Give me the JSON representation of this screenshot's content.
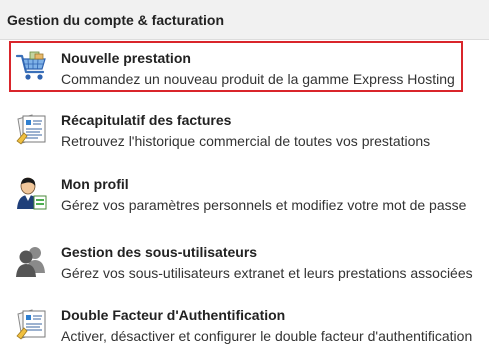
{
  "header": {
    "title": "Gestion du compte & facturation"
  },
  "items": [
    {
      "title": "Nouvelle prestation",
      "description": "Commandez un nouveau produit de la gamme Express Hosting",
      "icon": "shopping-cart-icon"
    },
    {
      "title": "Récapitulatif des factures",
      "description": "Retrouvez l'historique commercial de toutes vos prestations",
      "icon": "invoice-document-icon"
    },
    {
      "title": "Mon profil",
      "description": "Gérez vos paramètres personnels et modifiez votre mot de passe",
      "icon": "user-profile-icon"
    },
    {
      "title": "Gestion des sous-utilisateurs",
      "description": "Gérez vos sous-utilisateurs extranet et leurs prestations associées",
      "icon": "users-group-icon"
    },
    {
      "title": "Double Facteur d'Authentification",
      "description": "Activer, désactiver et configurer le double facteur d'authentification",
      "icon": "two-factor-document-icon"
    }
  ],
  "colors": {
    "highlight": "#d9252b",
    "header_bg": "#f1f1f1"
  }
}
